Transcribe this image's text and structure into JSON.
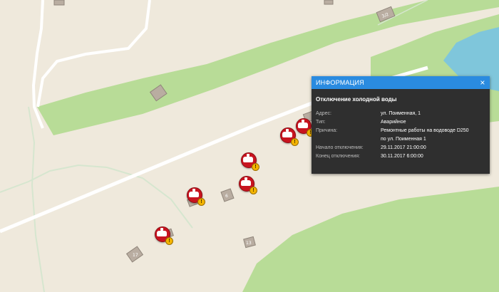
{
  "map": {
    "colors": {
      "land": "#efe9dc",
      "forest": "#b8dc97",
      "water": "#7fc6db",
      "road": "#ffffff",
      "path": "#d6e6cf",
      "building": "#b9ada1"
    },
    "buildings": [
      {
        "number": "3/2"
      },
      {
        "number": ""
      },
      {
        "number": "6"
      },
      {
        "number": "13"
      },
      {
        "number": "17"
      }
    ],
    "pins": [
      {
        "icon": "water-outage-icon"
      },
      {
        "icon": "water-outage-icon"
      },
      {
        "icon": "water-outage-icon"
      },
      {
        "icon": "water-outage-icon"
      },
      {
        "icon": "water-outage-icon"
      },
      {
        "icon": "water-outage-icon"
      }
    ]
  },
  "info": {
    "header": "ИНФОРМАЦИЯ",
    "close_icon": "×",
    "title": "Отключение холодной воды",
    "rows": [
      {
        "label": "Адрес:",
        "value": "ул. Поименная, 1"
      },
      {
        "label": "Тип:",
        "value": "Аварийное"
      },
      {
        "label": "Причина:",
        "value": "Ремонтные работы на водоводе D250"
      },
      {
        "label": "",
        "value": "по ул. Поименная 1"
      },
      {
        "label": "Начало отключения:",
        "value": "29.11.2017 21:00:00"
      },
      {
        "label": "Конец отключения:",
        "value": "30.11.2017 6:00:00"
      }
    ]
  }
}
